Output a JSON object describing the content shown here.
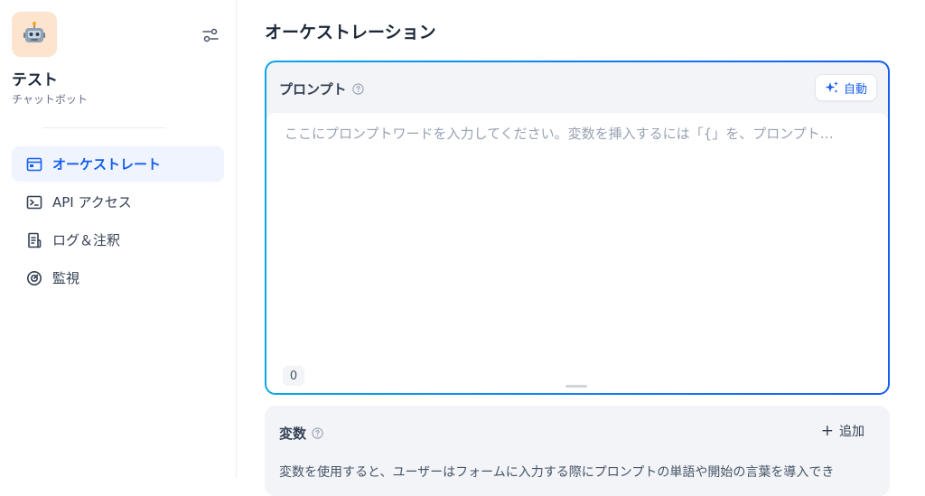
{
  "app": {
    "name": "テスト",
    "type": "チャットボット"
  },
  "sidebar": {
    "items": [
      {
        "label": "オーケストレート",
        "icon": "terminal-window-icon",
        "active": true
      },
      {
        "label": "API アクセス",
        "icon": "terminal-square-icon",
        "active": false
      },
      {
        "label": "ログ＆注釈",
        "icon": "file-list-icon",
        "active": false
      },
      {
        "label": "監視",
        "icon": "dashboard-gauge-icon",
        "active": false
      }
    ]
  },
  "main": {
    "title": "オーケストレーション",
    "prompt": {
      "label": "プロンプト",
      "auto_label": "自動",
      "placeholder": "ここにプロンプトワードを入力してください。変数を挿入するには「{」を、プロンプト…",
      "char_count": "0"
    },
    "variables": {
      "label": "変数",
      "add_label": "追加",
      "description": "変数を使用すると、ユーザーはフォームに入力する際にプロンプトの単語や開始の言葉を導入でき"
    }
  },
  "colors": {
    "accent": "#155eef",
    "gradient_start": "#0ba5ec",
    "active_bg": "#eff4ff"
  }
}
